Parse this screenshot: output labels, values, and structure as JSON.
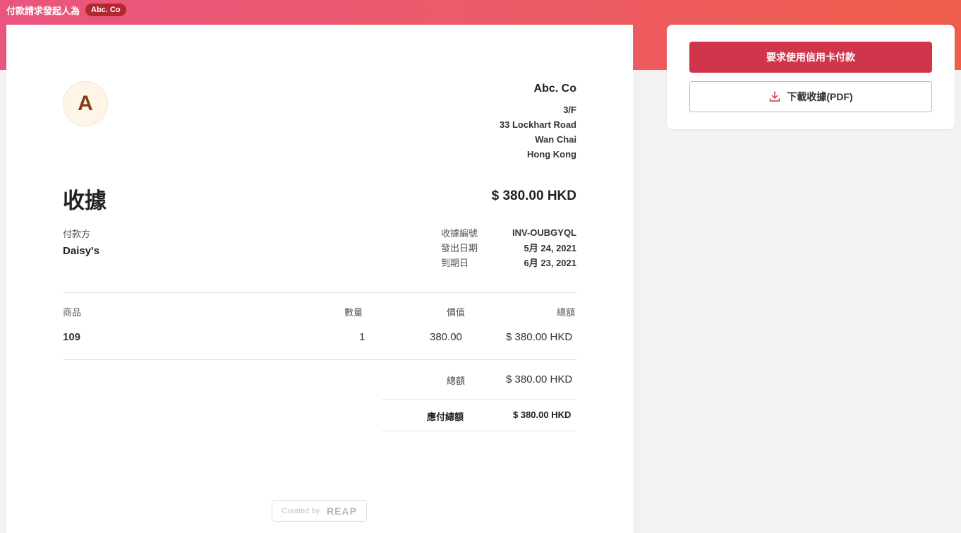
{
  "top_bar": {
    "title": "付款請求發起人為",
    "badge": "Abc. Co"
  },
  "receipt": {
    "avatar_letter": "A",
    "company": {
      "name": "Abc. Co",
      "address": [
        "3/F",
        "33 Lockhart Road",
        "Wan Chai",
        "Hong Kong"
      ]
    },
    "title": "收據",
    "amount": "$ 380.00 HKD",
    "payer_label": "付款方",
    "payer_name": "Daisy's",
    "meta": [
      {
        "key": "收據編號",
        "value": "INV-OUBGYQL"
      },
      {
        "key": "發出日期",
        "value": "5月 24, 2021"
      },
      {
        "key": "到期日",
        "value": "6月 23, 2021"
      }
    ],
    "table": {
      "headers": {
        "item": "商品",
        "qty": "數量",
        "price": "價值",
        "total": "總額"
      },
      "rows": [
        {
          "item": "109",
          "qty": "1",
          "price": "380.00",
          "total": "$ 380.00 HKD"
        }
      ]
    },
    "summary": {
      "total_label": "總額",
      "total_value": "$ 380.00 HKD",
      "due_label": "應付總額",
      "due_value": "$ 380.00 HKD"
    },
    "footer": {
      "created_by": "Created by",
      "brand": "REAP"
    }
  },
  "actions": {
    "pay_button": "要求使用信用卡付款",
    "download_button": "下載收據(PDF)"
  },
  "colors": {
    "primary": "#d0354c",
    "gradient_start": "#e9557e",
    "gradient_end": "#ee5d4a"
  }
}
